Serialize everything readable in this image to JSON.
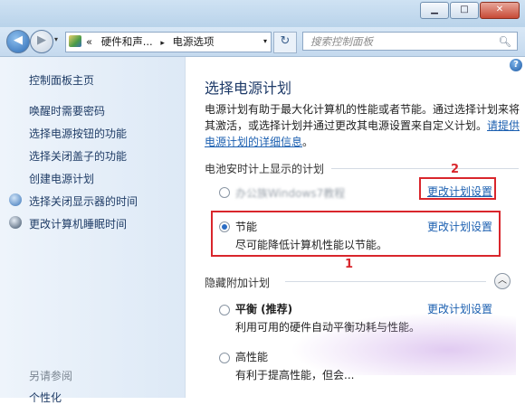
{
  "window": {
    "minimize": "▁",
    "maximize": "□",
    "close": "✕"
  },
  "nav": {
    "back": "◀",
    "forward": "▶",
    "dropdown": "▾",
    "address": {
      "chevrons": "«",
      "part1": "硬件和声...",
      "sep": "▸",
      "part2": "电源选项",
      "dropdown": "▾"
    },
    "refresh": "↻",
    "search_placeholder": "搜索控制面板",
    "search_icon": "search-icon"
  },
  "sidebar": {
    "home": "控制面板主页",
    "items": [
      {
        "label": "唤醒时需要密码"
      },
      {
        "label": "选择电源按钮的功能"
      },
      {
        "label": "选择关闭盖子的功能"
      },
      {
        "label": "创建电源计划"
      },
      {
        "label": "选择关闭显示器的时间",
        "icon": "display-icon"
      },
      {
        "label": "更改计算机睡眠时间",
        "icon": "sleep-icon"
      }
    ],
    "see_also": "另请参阅",
    "personalize": "个性化"
  },
  "main": {
    "help": "?",
    "title": "选择电源计划",
    "description_text": "电源计划有助于最大化计算机的性能或者节能。通过选择计划来将其激活，或选择计划并通过更改其电源设置来自定义计划。",
    "description_link": "请提供电源计划的详细信息",
    "description_end": "。",
    "battery_group_title": "电池安时计上显示的计划",
    "plan_blurred_name": "办公族Windows7教程",
    "change_link": "更改计划设置",
    "plan_power_saver": {
      "name": "节能",
      "description": "尽可能降低计算机性能以节能。"
    },
    "hidden_group_title": "隐藏附加计划",
    "collapse_icon": "︿",
    "plan_balanced": {
      "name": "平衡 (推荐)",
      "description": "利用可用的硬件自动平衡功耗与性能。"
    },
    "plan_high": {
      "name": "高性能",
      "description": "有利于提高性能，但会..."
    }
  },
  "annotations": {
    "label1": "1",
    "label2": "2",
    "color": "#d9262c"
  },
  "colors": {
    "link": "#1b5fb0",
    "sidebar_link": "#1f3c66",
    "title": "#1e3a68"
  }
}
